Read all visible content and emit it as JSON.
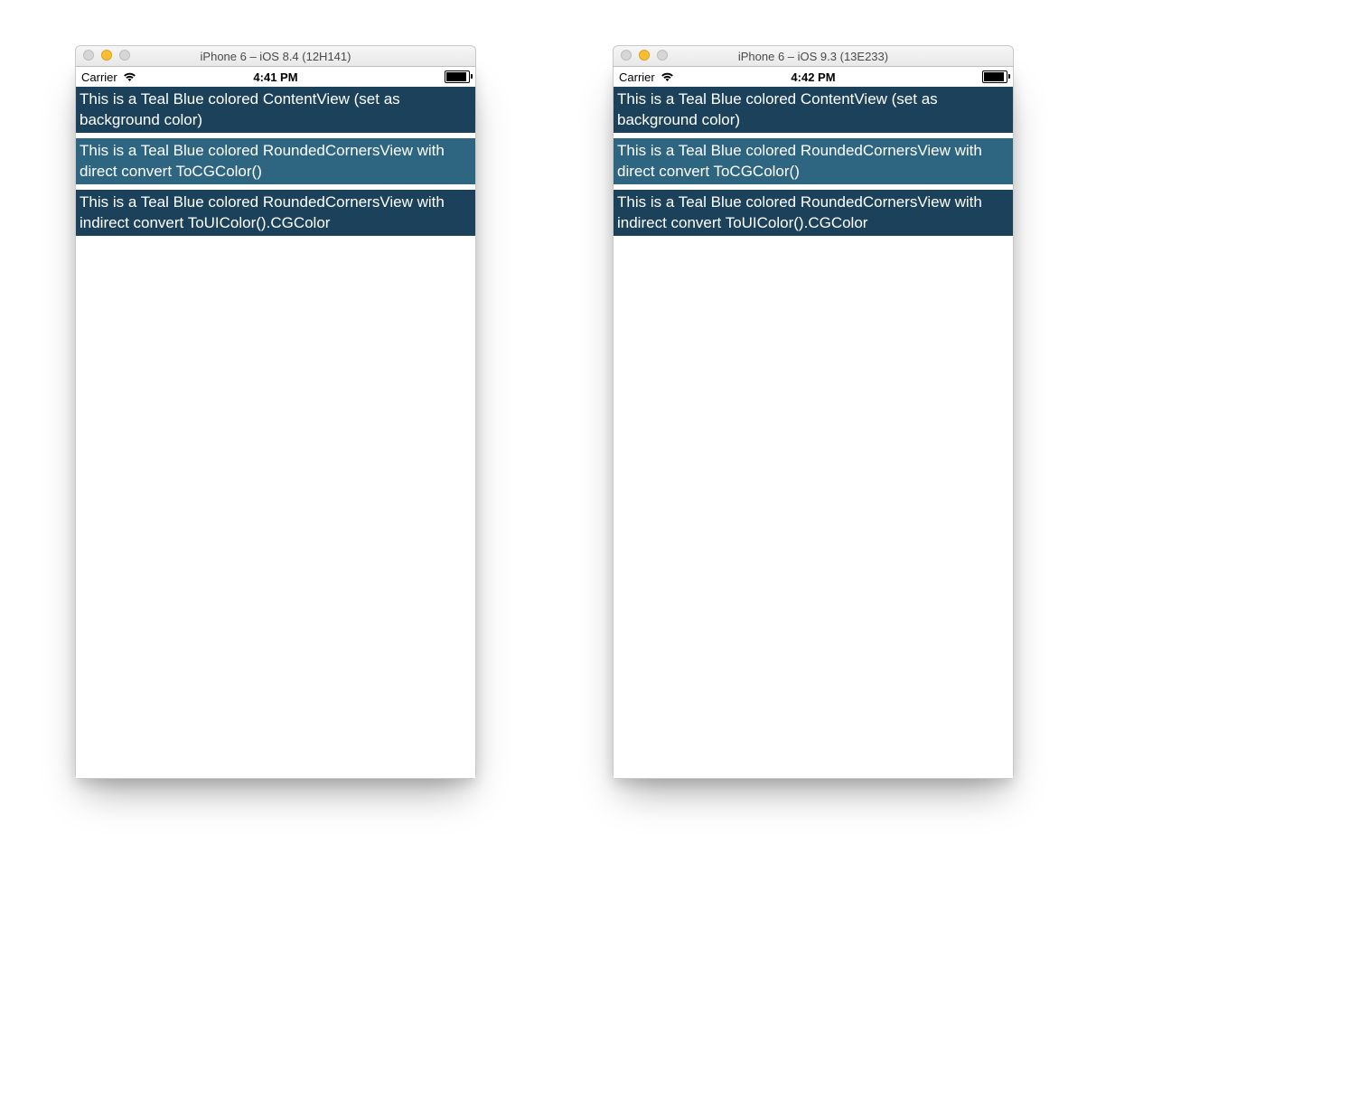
{
  "colors": {
    "teal_dark": "#1c425b",
    "teal_mid": "#2e6580"
  },
  "simulators": [
    {
      "window_title": "iPhone 6 – iOS 8.4 (12H141)",
      "statusbar": {
        "carrier": "Carrier",
        "time": "4:41 PM"
      },
      "rows": [
        {
          "text": "This is a Teal Blue colored ContentView (set as background color)",
          "shade": "teal-dark"
        },
        {
          "text": "This is a Teal Blue colored RoundedCornersView with direct convert ToCGColor()",
          "shade": "teal-mid"
        },
        {
          "text": "This is a Teal Blue colored RoundedCornersView with indirect convert ToUIColor().CGColor",
          "shade": "teal-dark"
        }
      ]
    },
    {
      "window_title": "iPhone 6 – iOS 9.3 (13E233)",
      "statusbar": {
        "carrier": "Carrier",
        "time": "4:42 PM"
      },
      "rows": [
        {
          "text": "This is a Teal Blue colored ContentView (set as background color)",
          "shade": "teal-dark"
        },
        {
          "text": "This is a Teal Blue colored RoundedCornersView with direct convert ToCGColor()",
          "shade": "teal-mid"
        },
        {
          "text": "This is a Teal Blue colored RoundedCornersView with indirect convert ToUIColor().CGColor",
          "shade": "teal-dark"
        }
      ]
    }
  ]
}
